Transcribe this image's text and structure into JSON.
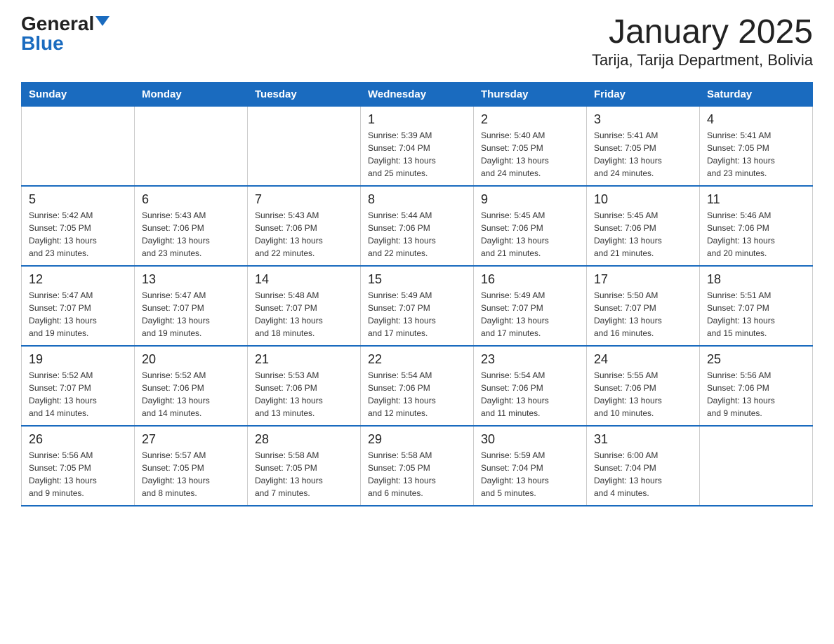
{
  "logo": {
    "general": "General",
    "blue": "Blue"
  },
  "title": "January 2025",
  "subtitle": "Tarija, Tarija Department, Bolivia",
  "days_of_week": [
    "Sunday",
    "Monday",
    "Tuesday",
    "Wednesday",
    "Thursday",
    "Friday",
    "Saturday"
  ],
  "weeks": [
    [
      {
        "day": "",
        "info": ""
      },
      {
        "day": "",
        "info": ""
      },
      {
        "day": "",
        "info": ""
      },
      {
        "day": "1",
        "info": "Sunrise: 5:39 AM\nSunset: 7:04 PM\nDaylight: 13 hours\nand 25 minutes."
      },
      {
        "day": "2",
        "info": "Sunrise: 5:40 AM\nSunset: 7:05 PM\nDaylight: 13 hours\nand 24 minutes."
      },
      {
        "day": "3",
        "info": "Sunrise: 5:41 AM\nSunset: 7:05 PM\nDaylight: 13 hours\nand 24 minutes."
      },
      {
        "day": "4",
        "info": "Sunrise: 5:41 AM\nSunset: 7:05 PM\nDaylight: 13 hours\nand 23 minutes."
      }
    ],
    [
      {
        "day": "5",
        "info": "Sunrise: 5:42 AM\nSunset: 7:05 PM\nDaylight: 13 hours\nand 23 minutes."
      },
      {
        "day": "6",
        "info": "Sunrise: 5:43 AM\nSunset: 7:06 PM\nDaylight: 13 hours\nand 23 minutes."
      },
      {
        "day": "7",
        "info": "Sunrise: 5:43 AM\nSunset: 7:06 PM\nDaylight: 13 hours\nand 22 minutes."
      },
      {
        "day": "8",
        "info": "Sunrise: 5:44 AM\nSunset: 7:06 PM\nDaylight: 13 hours\nand 22 minutes."
      },
      {
        "day": "9",
        "info": "Sunrise: 5:45 AM\nSunset: 7:06 PM\nDaylight: 13 hours\nand 21 minutes."
      },
      {
        "day": "10",
        "info": "Sunrise: 5:45 AM\nSunset: 7:06 PM\nDaylight: 13 hours\nand 21 minutes."
      },
      {
        "day": "11",
        "info": "Sunrise: 5:46 AM\nSunset: 7:06 PM\nDaylight: 13 hours\nand 20 minutes."
      }
    ],
    [
      {
        "day": "12",
        "info": "Sunrise: 5:47 AM\nSunset: 7:07 PM\nDaylight: 13 hours\nand 19 minutes."
      },
      {
        "day": "13",
        "info": "Sunrise: 5:47 AM\nSunset: 7:07 PM\nDaylight: 13 hours\nand 19 minutes."
      },
      {
        "day": "14",
        "info": "Sunrise: 5:48 AM\nSunset: 7:07 PM\nDaylight: 13 hours\nand 18 minutes."
      },
      {
        "day": "15",
        "info": "Sunrise: 5:49 AM\nSunset: 7:07 PM\nDaylight: 13 hours\nand 17 minutes."
      },
      {
        "day": "16",
        "info": "Sunrise: 5:49 AM\nSunset: 7:07 PM\nDaylight: 13 hours\nand 17 minutes."
      },
      {
        "day": "17",
        "info": "Sunrise: 5:50 AM\nSunset: 7:07 PM\nDaylight: 13 hours\nand 16 minutes."
      },
      {
        "day": "18",
        "info": "Sunrise: 5:51 AM\nSunset: 7:07 PM\nDaylight: 13 hours\nand 15 minutes."
      }
    ],
    [
      {
        "day": "19",
        "info": "Sunrise: 5:52 AM\nSunset: 7:07 PM\nDaylight: 13 hours\nand 14 minutes."
      },
      {
        "day": "20",
        "info": "Sunrise: 5:52 AM\nSunset: 7:06 PM\nDaylight: 13 hours\nand 14 minutes."
      },
      {
        "day": "21",
        "info": "Sunrise: 5:53 AM\nSunset: 7:06 PM\nDaylight: 13 hours\nand 13 minutes."
      },
      {
        "day": "22",
        "info": "Sunrise: 5:54 AM\nSunset: 7:06 PM\nDaylight: 13 hours\nand 12 minutes."
      },
      {
        "day": "23",
        "info": "Sunrise: 5:54 AM\nSunset: 7:06 PM\nDaylight: 13 hours\nand 11 minutes."
      },
      {
        "day": "24",
        "info": "Sunrise: 5:55 AM\nSunset: 7:06 PM\nDaylight: 13 hours\nand 10 minutes."
      },
      {
        "day": "25",
        "info": "Sunrise: 5:56 AM\nSunset: 7:06 PM\nDaylight: 13 hours\nand 9 minutes."
      }
    ],
    [
      {
        "day": "26",
        "info": "Sunrise: 5:56 AM\nSunset: 7:05 PM\nDaylight: 13 hours\nand 9 minutes."
      },
      {
        "day": "27",
        "info": "Sunrise: 5:57 AM\nSunset: 7:05 PM\nDaylight: 13 hours\nand 8 minutes."
      },
      {
        "day": "28",
        "info": "Sunrise: 5:58 AM\nSunset: 7:05 PM\nDaylight: 13 hours\nand 7 minutes."
      },
      {
        "day": "29",
        "info": "Sunrise: 5:58 AM\nSunset: 7:05 PM\nDaylight: 13 hours\nand 6 minutes."
      },
      {
        "day": "30",
        "info": "Sunrise: 5:59 AM\nSunset: 7:04 PM\nDaylight: 13 hours\nand 5 minutes."
      },
      {
        "day": "31",
        "info": "Sunrise: 6:00 AM\nSunset: 7:04 PM\nDaylight: 13 hours\nand 4 minutes."
      },
      {
        "day": "",
        "info": ""
      }
    ]
  ]
}
